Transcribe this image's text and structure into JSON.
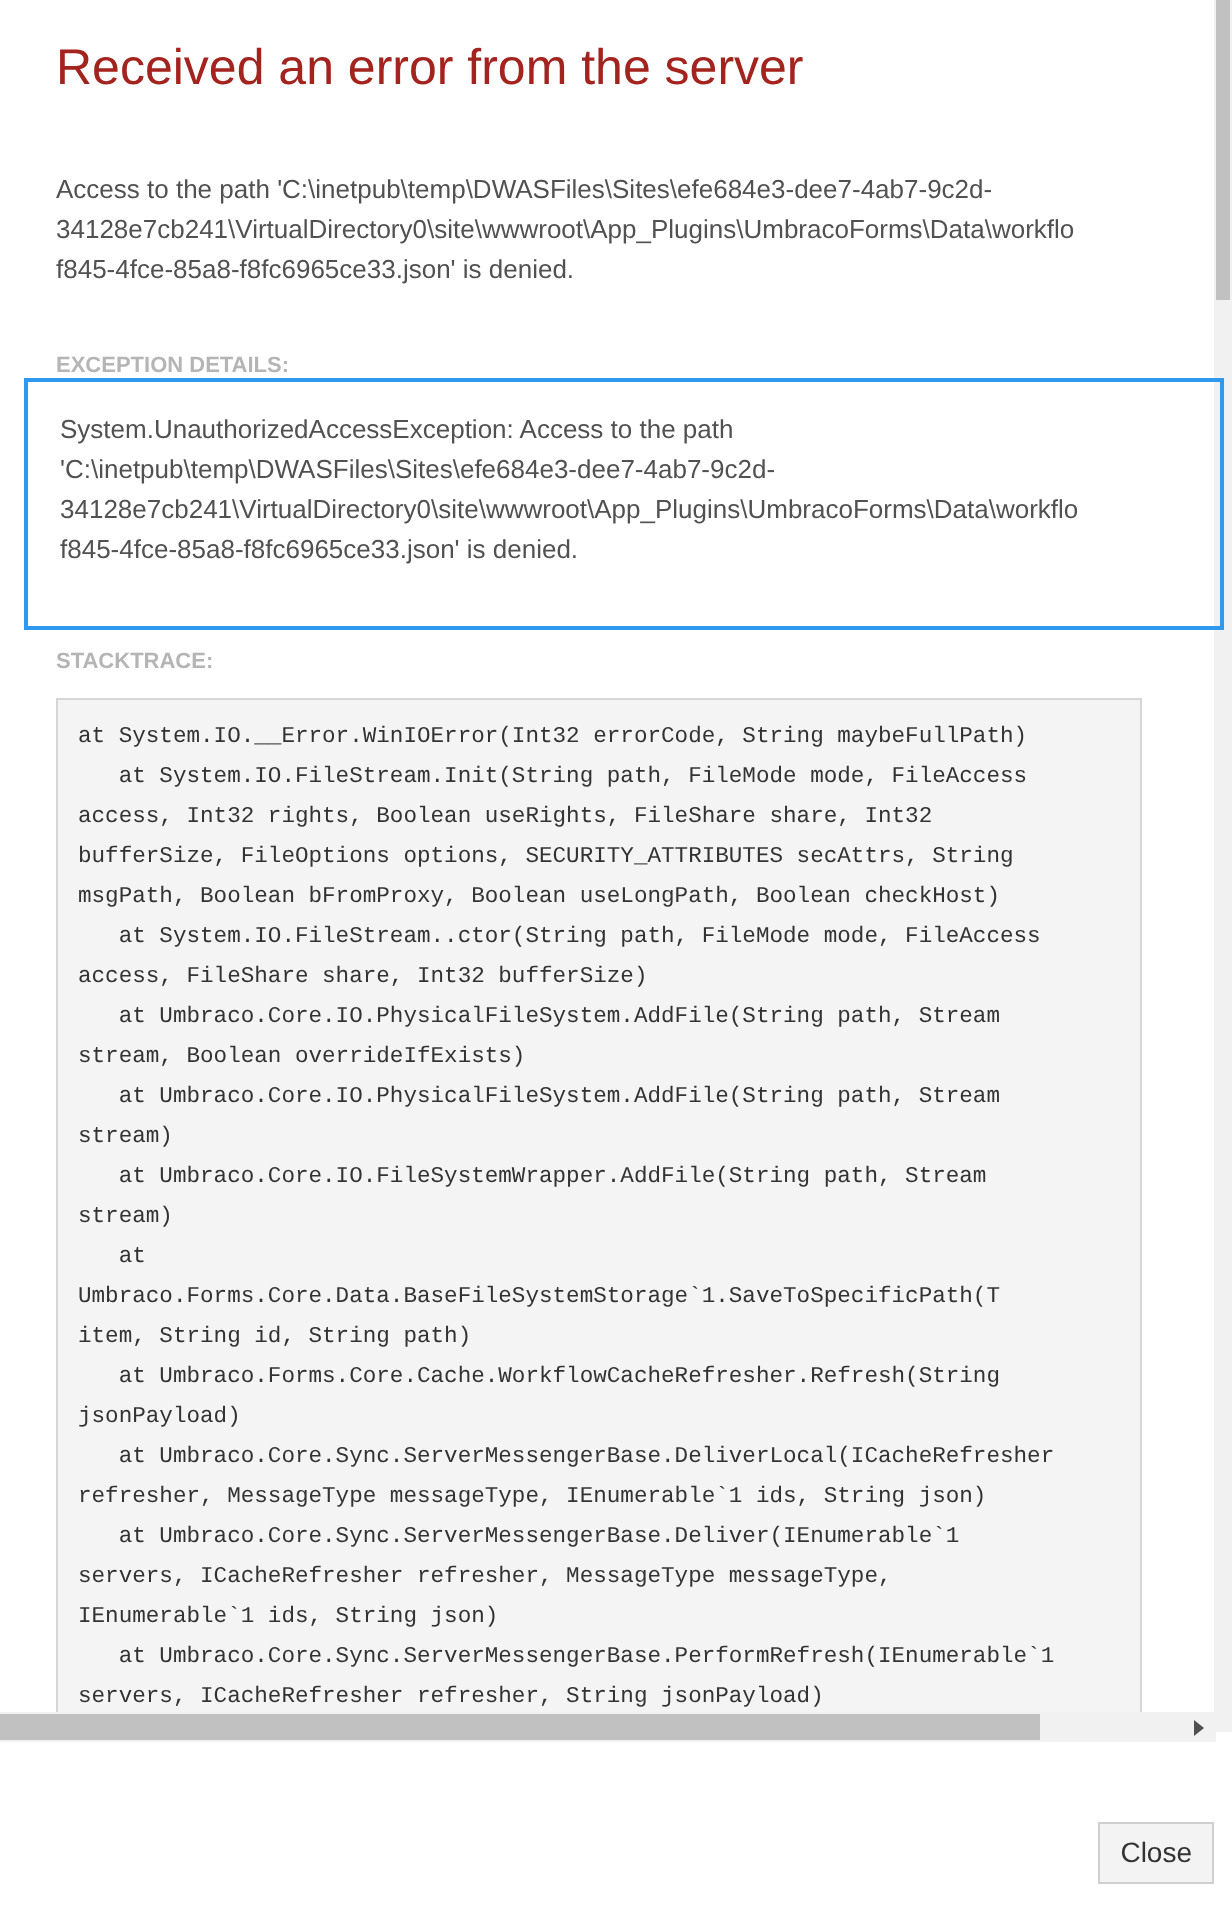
{
  "dialog": {
    "title": "Received an error from the server",
    "message": "Access to the path 'C:\\inetpub\\temp\\DWASFiles\\Sites\\efe684e3-dee7-4ab7-9c2d-\n34128e7cb241\\VirtualDirectory0\\site\\wwwroot\\App_Plugins\\UmbracoForms\\Data\\workflo\nf845-4fce-85a8-f8fc6965ce33.json' is denied.",
    "exception": {
      "heading": "EXCEPTION DETAILS:",
      "focused": true,
      "text": "System.UnauthorizedAccessException: Access to the path\n'C:\\inetpub\\temp\\DWASFiles\\Sites\\efe684e3-dee7-4ab7-9c2d-\n34128e7cb241\\VirtualDirectory0\\site\\wwwroot\\App_Plugins\\UmbracoForms\\Data\\workflo\nf845-4fce-85a8-f8fc6965ce33.json' is denied."
    },
    "stacktrace": {
      "heading": "STACKTRACE:",
      "lines": [
        "at System.IO.__Error.WinIOError(Int32 errorCode, String maybeFullPath)",
        "   at System.IO.FileStream.Init(String path, FileMode mode, FileAccess",
        "access, Int32 rights, Boolean useRights, FileShare share, Int32",
        "bufferSize, FileOptions options, SECURITY_ATTRIBUTES secAttrs, String",
        "msgPath, Boolean bFromProxy, Boolean useLongPath, Boolean checkHost)",
        "   at System.IO.FileStream..ctor(String path, FileMode mode, FileAccess",
        "access, FileShare share, Int32 bufferSize)",
        "   at Umbraco.Core.IO.PhysicalFileSystem.AddFile(String path, Stream",
        "stream, Boolean overrideIfExists)",
        "   at Umbraco.Core.IO.PhysicalFileSystem.AddFile(String path, Stream",
        "stream)",
        "   at Umbraco.Core.IO.FileSystemWrapper.AddFile(String path, Stream",
        "stream)",
        "   at",
        "Umbraco.Forms.Core.Data.BaseFileSystemStorage`1.SaveToSpecificPath(T",
        "item, String id, String path)",
        "   at Umbraco.Forms.Core.Cache.WorkflowCacheRefresher.Refresh(String",
        "jsonPayload)",
        "   at Umbraco.Core.Sync.ServerMessengerBase.DeliverLocal(ICacheRefresher",
        "refresher, MessageType messageType, IEnumerable`1 ids, String json)",
        "   at Umbraco.Core.Sync.ServerMessengerBase.Deliver(IEnumerable`1",
        "servers, ICacheRefresher refresher, MessageType messageType,",
        "IEnumerable`1 ids, String json)",
        "   at Umbraco.Core.Sync.ServerMessengerBase.PerformRefresh(IEnumerable`1",
        "servers, ICacheRefresher refresher, String jsonPayload)"
      ]
    },
    "buttons": [
      {
        "label": "Close"
      }
    ]
  }
}
